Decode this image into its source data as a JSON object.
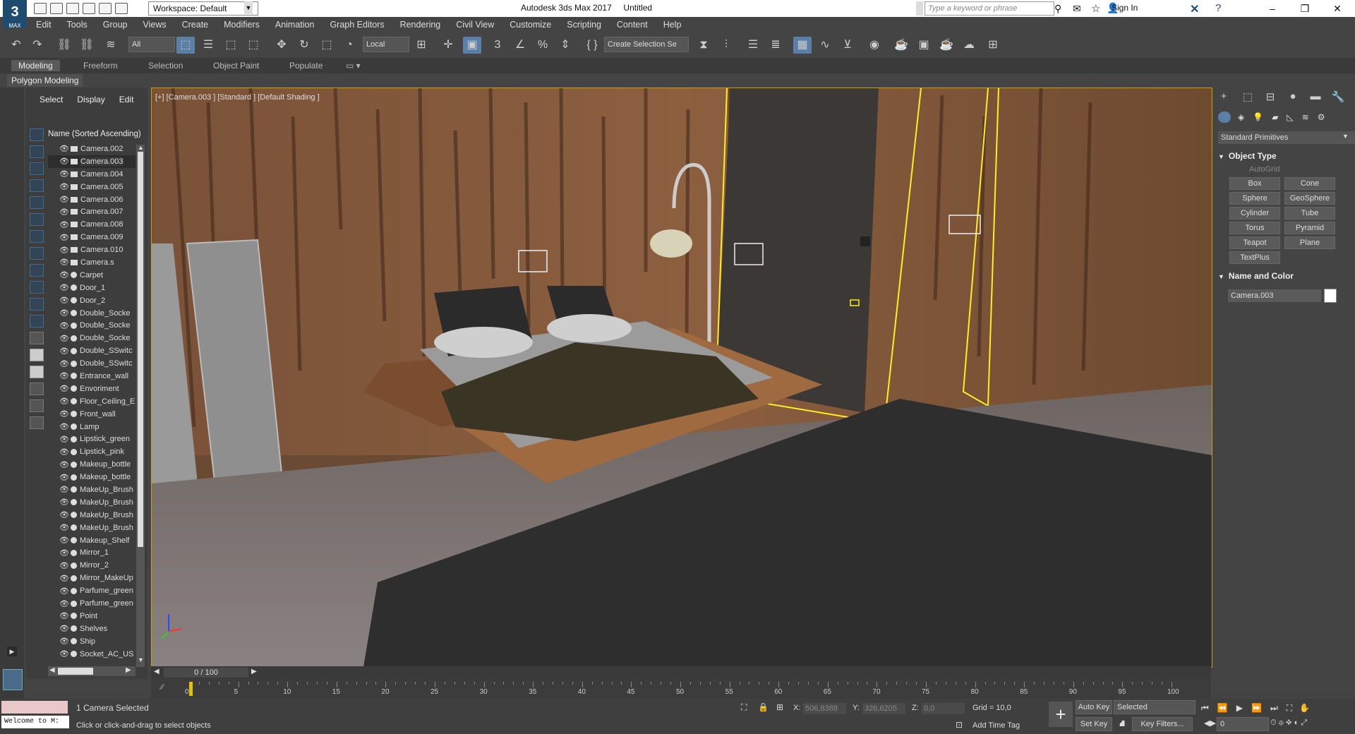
{
  "titlebar": {
    "workspace": "Workspace: Default",
    "app_title": "Autodesk 3ds Max 2017",
    "doc_title": "Untitled",
    "search_placeholder": "Type a keyword or phrase",
    "sign_in": "Sign In",
    "logo_text": "3",
    "logo_sub": "MAX"
  },
  "menu": [
    "Edit",
    "Tools",
    "Group",
    "Views",
    "Create",
    "Modifiers",
    "Animation",
    "Graph Editors",
    "Rendering",
    "Civil View",
    "Customize",
    "Scripting",
    "Content",
    "Help"
  ],
  "toolbar": {
    "filter": "All",
    "ref_coord": "Local",
    "selection_set": "Create Selection Se"
  },
  "ribbon": {
    "tabs": [
      "Modeling",
      "Freeform",
      "Selection",
      "Object Paint",
      "Populate"
    ],
    "panel": "Polygon Modeling"
  },
  "explorer": {
    "tabs": [
      "Select",
      "Display",
      "Edit"
    ],
    "header": "Name (Sorted Ascending)",
    "items": [
      {
        "name": "Camera.002",
        "type": "camera"
      },
      {
        "name": "Camera.003",
        "type": "camera",
        "selected": true
      },
      {
        "name": "Camera.004",
        "type": "camera"
      },
      {
        "name": "Camera.005",
        "type": "camera"
      },
      {
        "name": "Camera.006",
        "type": "camera"
      },
      {
        "name": "Camera.007",
        "type": "camera"
      },
      {
        "name": "Camera.008",
        "type": "camera"
      },
      {
        "name": "Camera.009",
        "type": "camera"
      },
      {
        "name": "Camera.010",
        "type": "camera"
      },
      {
        "name": "Camera.s",
        "type": "camera"
      },
      {
        "name": "Carpet",
        "type": "geometry"
      },
      {
        "name": "Door_1",
        "type": "geometry"
      },
      {
        "name": "Door_2",
        "type": "geometry"
      },
      {
        "name": "Double_Socke",
        "type": "geometry"
      },
      {
        "name": "Double_Socke",
        "type": "geometry"
      },
      {
        "name": "Double_Socke",
        "type": "geometry"
      },
      {
        "name": "Double_SSwitc",
        "type": "geometry"
      },
      {
        "name": "Double_SSwitc",
        "type": "geometry"
      },
      {
        "name": "Entrance_wall",
        "type": "geometry"
      },
      {
        "name": "Envoriment",
        "type": "geometry"
      },
      {
        "name": "Floor_Ceiling_E",
        "type": "geometry"
      },
      {
        "name": "Front_wall",
        "type": "geometry"
      },
      {
        "name": "Lamp",
        "type": "geometry"
      },
      {
        "name": "Lipstick_green",
        "type": "geometry"
      },
      {
        "name": "Lipstick_pink",
        "type": "geometry"
      },
      {
        "name": "Makeup_bottle",
        "type": "geometry"
      },
      {
        "name": "Makeup_bottle",
        "type": "geometry"
      },
      {
        "name": "MakeUp_Brush",
        "type": "geometry"
      },
      {
        "name": "MakeUp_Brush",
        "type": "geometry"
      },
      {
        "name": "MakeUp_Brush",
        "type": "geometry"
      },
      {
        "name": "MakeUp_Brush",
        "type": "geometry"
      },
      {
        "name": "Makeup_Shelf",
        "type": "geometry"
      },
      {
        "name": "Mirror_1",
        "type": "geometry"
      },
      {
        "name": "Mirror_2",
        "type": "geometry"
      },
      {
        "name": "Mirror_MakeUp",
        "type": "geometry"
      },
      {
        "name": "Parfume_green",
        "type": "geometry"
      },
      {
        "name": "Parfume_green",
        "type": "geometry"
      },
      {
        "name": "Point",
        "type": "light"
      },
      {
        "name": "Shelves",
        "type": "geometry"
      },
      {
        "name": "Ship",
        "type": "geometry"
      },
      {
        "name": "Socket_AC_US",
        "type": "geometry"
      }
    ]
  },
  "viewport": {
    "label": "[+] [Camera.003 ] [Standard ] [Default Shading ]"
  },
  "command_panel": {
    "category": "Standard Primitives",
    "object_type_title": "Object Type",
    "autogrid": "AutoGrid",
    "primitives": [
      "Box",
      "Cone",
      "Sphere",
      "GeoSphere",
      "Cylinder",
      "Tube",
      "Torus",
      "Pyramid",
      "Teapot",
      "Plane",
      "TextPlus"
    ],
    "name_color_title": "Name and Color",
    "object_name": "Camera.003",
    "object_color": "#ffffff"
  },
  "timeline": {
    "slider_value": "0 / 100",
    "tick_labels": [
      "0",
      "5",
      "10",
      "15",
      "20",
      "25",
      "30",
      "35",
      "40",
      "45",
      "50",
      "55",
      "60",
      "65",
      "70",
      "75",
      "80",
      "85",
      "90",
      "95",
      "100"
    ]
  },
  "status": {
    "selection": "1 Camera Selected",
    "prompt": "Click or click-and-drag to select objects",
    "maxscript": "Welcome to M:",
    "x_label": "X:",
    "x_value": "506,8388",
    "y_label": "Y:",
    "y_value": "326,6205",
    "z_label": "Z:",
    "z_value": "0,0",
    "grid": "Grid = 10,0",
    "add_time_tag": "Add Time Tag",
    "auto_key": "Auto Key",
    "set_key": "Set Key",
    "key_mode": "Selected",
    "key_filters": "Key Filters...",
    "frame": "0"
  }
}
